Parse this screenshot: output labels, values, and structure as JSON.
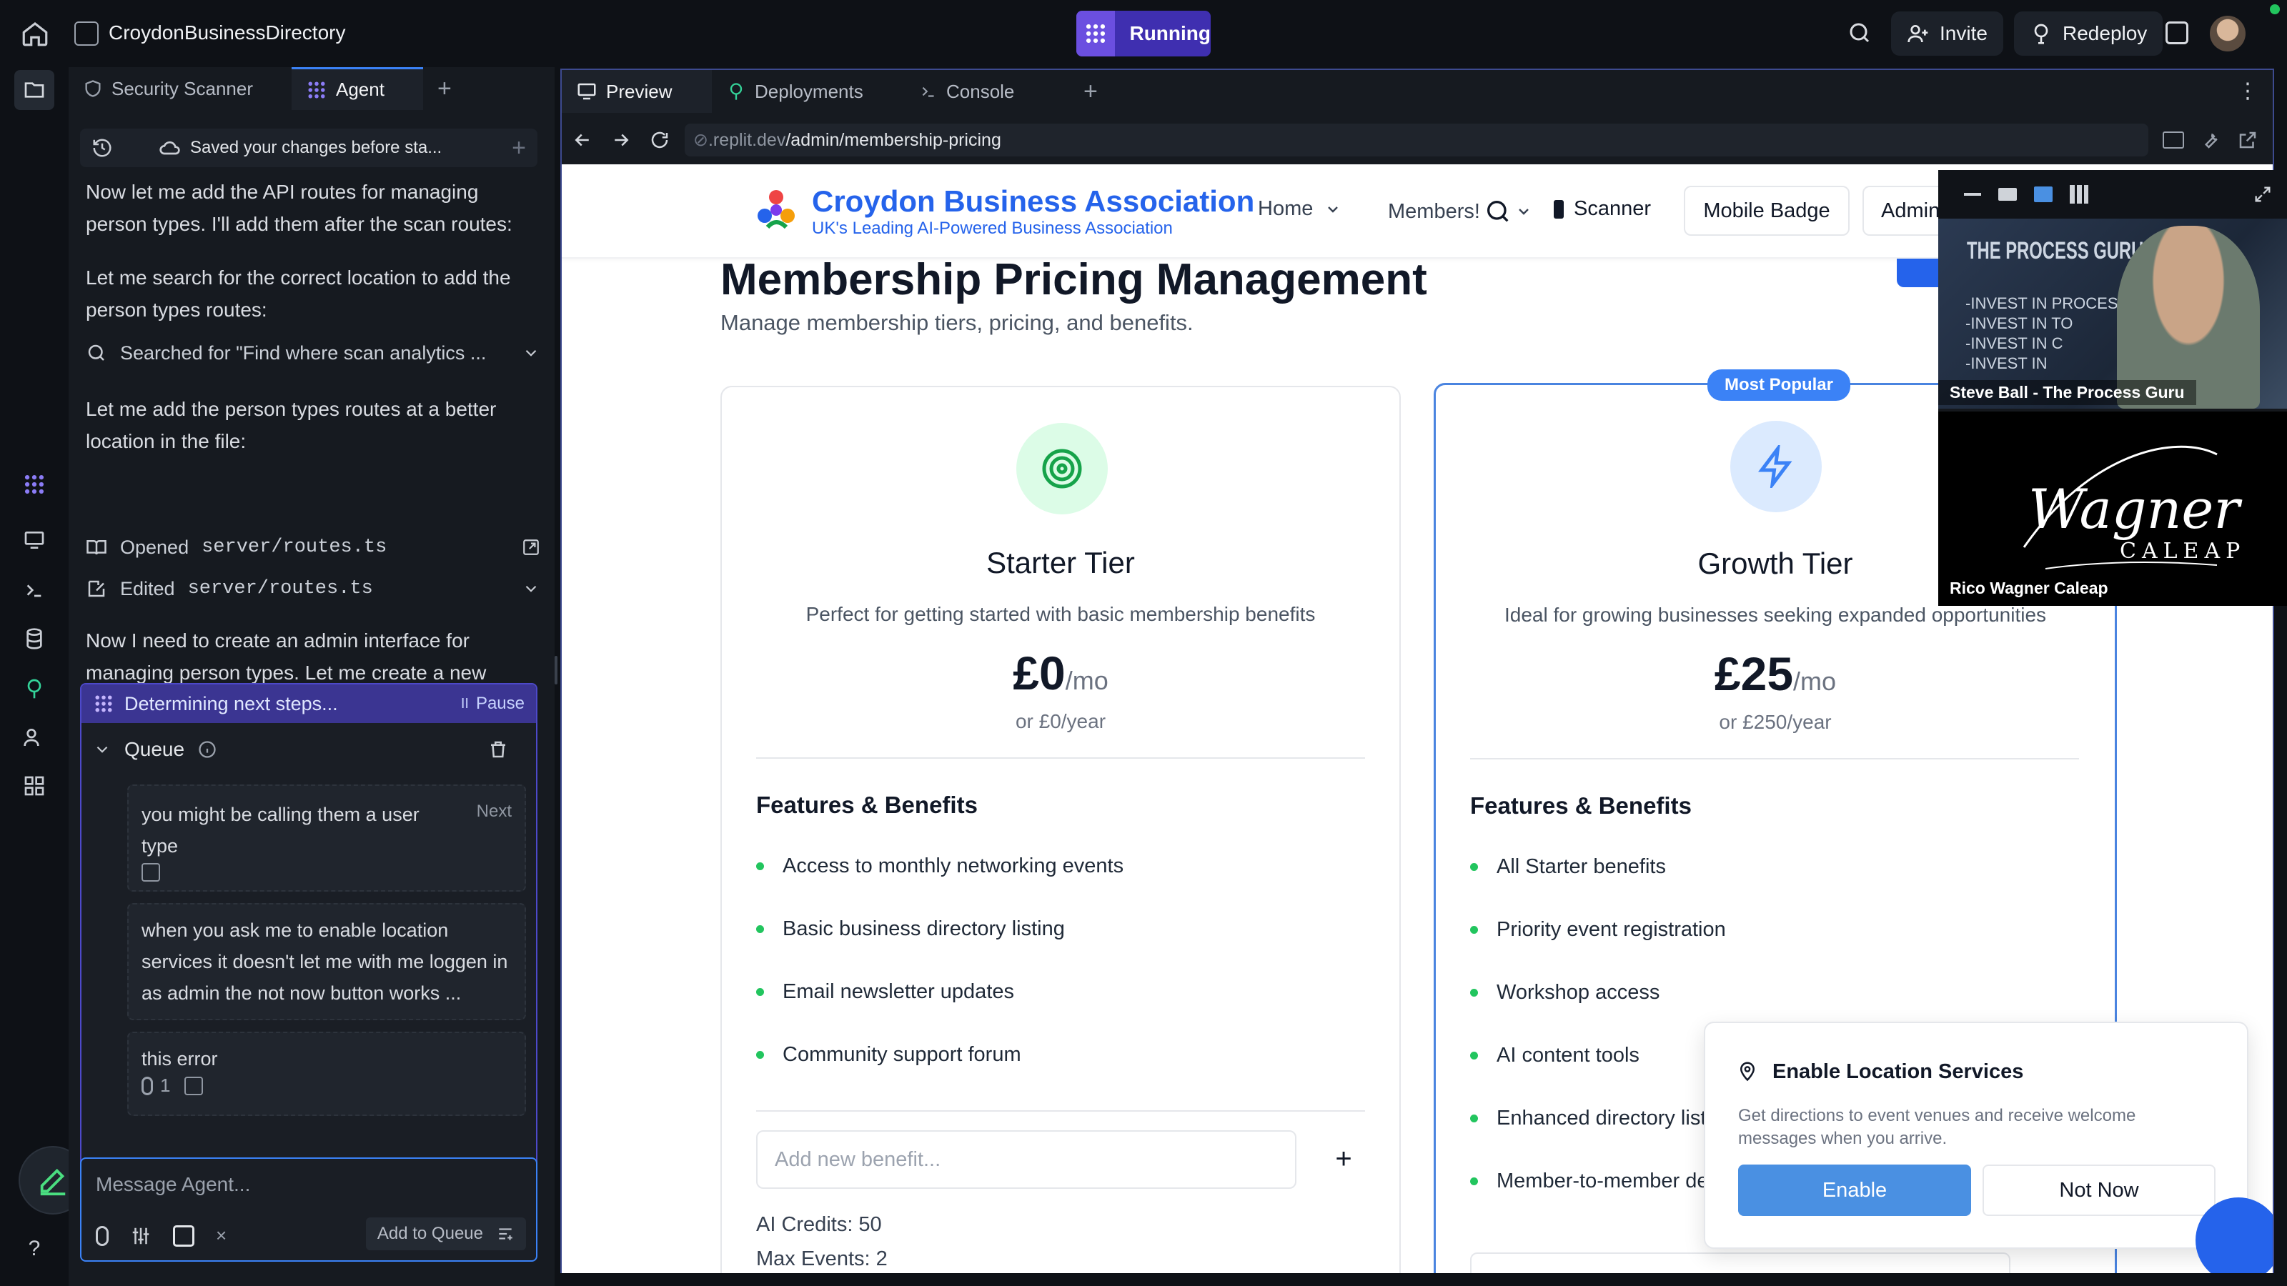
{
  "topbar": {
    "project_name": "CroydonBusinessDirectory",
    "status": "Running",
    "invite_label": "Invite",
    "redeploy_label": "Redeploy"
  },
  "agent_panel": {
    "tabs": [
      {
        "label": "Security Scanner"
      },
      {
        "label": "Agent"
      }
    ],
    "checkpoint_text": "Saved your changes before sta...",
    "messages": [
      "Now let me add the API routes for managing person types. I'll add them after the scan routes:",
      "Let me search for the correct location to add the person types routes:",
      "Let me add the person types routes at a better location in the file:",
      "Now I need to create an admin interface for managing person types. Let me create a new admin page for this:"
    ],
    "search_action": "Searched for \"Find where scan analytics ...",
    "opened_label": "Opened",
    "opened_file": "server/routes.ts",
    "edited_label": "Edited",
    "edited_file": "server/routes.ts",
    "status_text": "Determining next steps...",
    "pause_label": "Pause",
    "queue_label": "Queue",
    "queue_items": [
      {
        "text": "you might be calling them a user type",
        "tag": "Next"
      },
      {
        "text": "when you ask me to enable location services it doesn't let me with me loggen in as admin the not now button works ..."
      },
      {
        "text": "this error",
        "attachments": "1"
      }
    ],
    "input_placeholder": "Message Agent...",
    "add_to_queue_label": "Add to Queue"
  },
  "preview": {
    "tabs": [
      {
        "label": "Preview"
      },
      {
        "label": "Deployments"
      },
      {
        "label": "Console"
      }
    ],
    "url_prefix": ".replit.dev",
    "url_path": "/admin/membership-pricing"
  },
  "site": {
    "brand_name": "Croydon Business Association",
    "brand_tagline": "UK's Leading AI-Powered Business Association",
    "nav": {
      "home": "Home",
      "members": "Members!",
      "scanner": "Scanner",
      "mobile_badge": "Mobile Badge",
      "admin": "Admin"
    },
    "page_title": "Membership Pricing Management",
    "page_subtitle": "Manage membership tiers, pricing, and benefits.",
    "features_heading": "Features & Benefits",
    "add_benefit_placeholder": "Add new benefit...",
    "tiers": [
      {
        "name": "Starter Tier",
        "description": "Perfect for getting started with basic membership benefits",
        "price": "£0",
        "period": "/mo",
        "yearly": "or £0/year",
        "features": [
          "Access to monthly networking events",
          "Basic business directory listing",
          "Email newsletter updates",
          "Community support forum"
        ],
        "ai_credits": "AI Credits: 50",
        "max_events": "Max Events: 2"
      },
      {
        "name": "Growth Tier",
        "badge": "Most Popular",
        "description": "Ideal for growing businesses seeking expanded opportunities",
        "price": "£25",
        "period": "/mo",
        "yearly": "or £250/year",
        "features": [
          "All Starter benefits",
          "Priority event registration",
          "Workshop access",
          "AI content tools",
          "Enhanced directory listing",
          "Member-to-member deals"
        ]
      }
    ]
  },
  "location_modal": {
    "title": "Enable Location Services",
    "body": "Get directions to event venues and receive welcome messages when you arrive.",
    "enable_label": "Enable",
    "not_now_label": "Not Now"
  },
  "video_call": {
    "participants": [
      {
        "name": "Steve Ball - The Process Guru",
        "backdrop_title": "THE PROCESS GURU WAY",
        "backdrop_lines": [
          "-INVEST IN PROCESS",
          "-INVEST IN TO",
          "-INVEST IN C",
          "-INVEST IN"
        ]
      },
      {
        "name": "Rico Wagner Caleap",
        "logo_script": "Wagner",
        "logo_caps": "CALEAP"
      }
    ]
  },
  "colors": {
    "accent": "#3b82f6",
    "brand_blue": "#2563eb",
    "running_purple": "#5b4bd6",
    "green_dot": "#22c55e",
    "modal_enable": "#4a90e2"
  }
}
